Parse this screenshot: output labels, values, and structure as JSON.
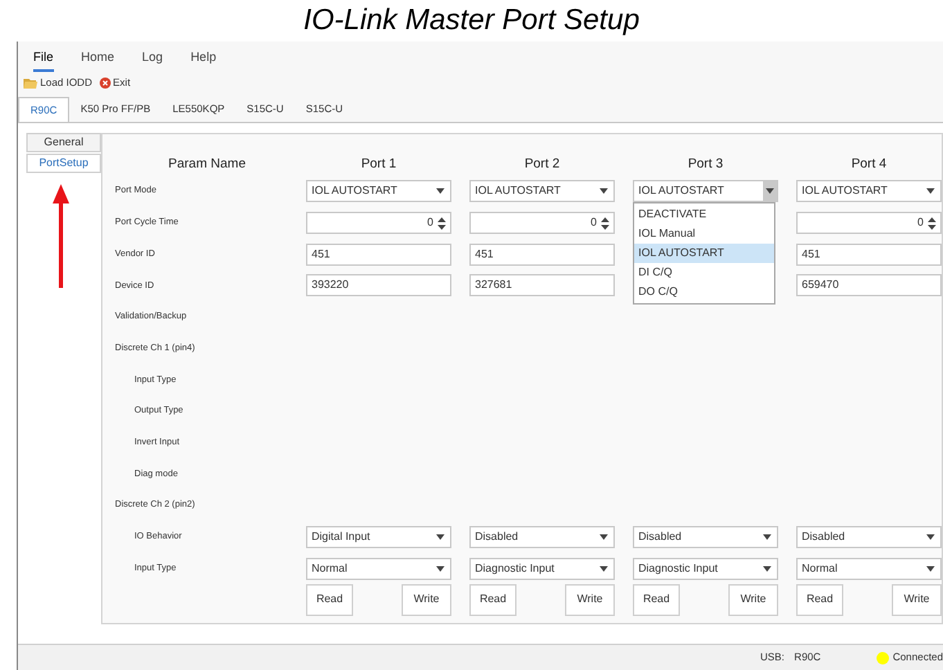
{
  "caption": "IO-Link Master Port Setup",
  "menu": [
    {
      "label": "File",
      "selected": true
    },
    {
      "label": "Home",
      "selected": false
    },
    {
      "label": "Log",
      "selected": false
    },
    {
      "label": "Help",
      "selected": false
    }
  ],
  "toolbar": [
    {
      "label": "Load IODD",
      "kind": "folder"
    },
    {
      "label": "Exit",
      "kind": "exit"
    }
  ],
  "device_tabs": [
    {
      "label": "R90C",
      "selected": true
    },
    {
      "label": "K50 Pro FF/PB",
      "selected": false
    },
    {
      "label": "LE550KQP",
      "selected": false
    },
    {
      "label": "S15C-U",
      "selected": false
    },
    {
      "label": "S15C-U",
      "selected": false
    }
  ],
  "side_tabs": [
    {
      "label": "General",
      "selected": false
    },
    {
      "label": "PortSetup",
      "selected": true
    }
  ],
  "grid": {
    "header": "Param Name",
    "ports": [
      "Port 1",
      "Port 2",
      "Port 3",
      "Port 4"
    ],
    "rows": [
      {
        "label": "Port Mode",
        "cells": [
          {
            "kind": "select",
            "value": "IOL AUTOSTART",
            "expanded": false
          },
          {
            "kind": "select",
            "value": "IOL AUTOSTART",
            "expanded": false
          },
          {
            "kind": "select",
            "value": "IOL AUTOSTART",
            "expanded": true,
            "options": [
              {
                "label": "DEACTIVATE",
                "selected": false
              },
              {
                "label": "IOL Manual",
                "selected": false
              },
              {
                "label": "IOL AUTOSTART",
                "selected": true
              },
              {
                "label": "DI C/Q",
                "selected": false
              },
              {
                "label": "DO C/Q",
                "selected": false
              }
            ]
          },
          {
            "kind": "select",
            "value": "IOL AUTOSTART",
            "expanded": false
          }
        ]
      },
      {
        "label": "Port Cycle Time",
        "cells": [
          {
            "kind": "spin",
            "value": "0"
          },
          {
            "kind": "spin",
            "value": "0"
          },
          null,
          {
            "kind": "spin",
            "value": "0"
          }
        ]
      },
      {
        "label": "Vendor ID",
        "cells": [
          {
            "kind": "text",
            "value": "451"
          },
          {
            "kind": "text",
            "value": "451"
          },
          null,
          {
            "kind": "text",
            "value": "451"
          }
        ]
      },
      {
        "label": "Device ID",
        "cells": [
          {
            "kind": "text",
            "value": "393220"
          },
          {
            "kind": "text",
            "value": "327681"
          },
          null,
          {
            "kind": "text",
            "value": "659470"
          }
        ]
      },
      {
        "label": "Validation/Backup"
      },
      {
        "label": "Discrete Ch 1 (pin4)",
        "children": [
          {
            "label": "Input Type"
          },
          {
            "label": "Output Type"
          },
          {
            "label": "Invert Input"
          },
          {
            "label": "Diag mode"
          }
        ]
      },
      {
        "label": "Discrete Ch 2 (pin2)",
        "children": [
          {
            "label": "IO Behavior",
            "cells": [
              {
                "kind": "select",
                "value": "Digital Input",
                "expanded": false
              },
              {
                "kind": "select",
                "value": "Disabled",
                "expanded": false
              },
              {
                "kind": "select",
                "value": "Disabled",
                "expanded": false
              },
              {
                "kind": "select",
                "value": "Disabled",
                "expanded": false
              }
            ]
          },
          {
            "label": "Input Type",
            "cells": [
              {
                "kind": "select",
                "value": "Normal",
                "expanded": false
              },
              {
                "kind": "select",
                "value": "Diagnostic Input",
                "expanded": false
              },
              {
                "kind": "select",
                "value": "Diagnostic Input",
                "expanded": false
              },
              {
                "kind": "select",
                "value": "Normal",
                "expanded": false
              }
            ]
          }
        ]
      }
    ],
    "buttons": [
      {
        "read": "Read",
        "write": "Write"
      },
      {
        "read": "Read",
        "write": "Write"
      },
      {
        "read": "Read",
        "write": "Write"
      },
      {
        "read": "Read",
        "write": "Write"
      }
    ]
  },
  "status_bar": {
    "port_label": "USB:",
    "port": "R90C",
    "connection": "Connected",
    "connected": true
  }
}
